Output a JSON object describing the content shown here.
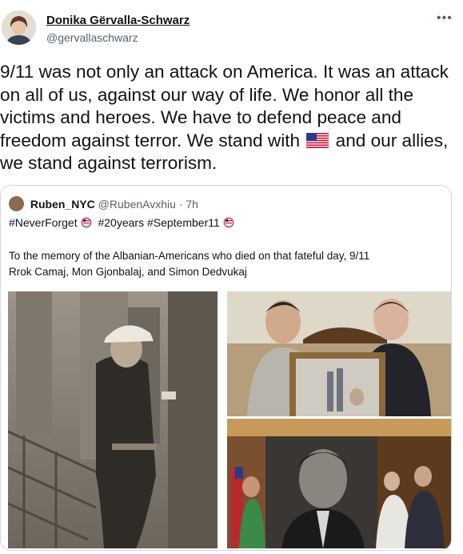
{
  "author": {
    "name": "Donika Gërvalla-Schwarz",
    "handle": "@gervallaschwarz"
  },
  "more_icon": "more-options-icon",
  "tweet": {
    "text_part1": "9/11 was not only an attack on America. It was an attack on all of us, against our way of life. We honor all the victims and heroes. We have to defend peace and freedom against terror. We stand with",
    "flag": "us-flag-icon",
    "text_part2": "and our allies, we stand against terrorism."
  },
  "quoted": {
    "name": "Ruben_NYC",
    "handle": "@RubenAvxhiu",
    "separator": "·",
    "time": "7h",
    "tag1": "#NeverForget",
    "tag2": "#20years",
    "tag3": "#September11",
    "body_line1": "To the memory of the Albanian-Americans who died on that fateful day, 9/11",
    "body_line2": "Rrok Camaj, Mon Gjonbalaj, and Simon Dedvukaj"
  },
  "colors": {
    "text": "#0f1419",
    "secondary": "#536471",
    "border": "#cfd9de"
  }
}
